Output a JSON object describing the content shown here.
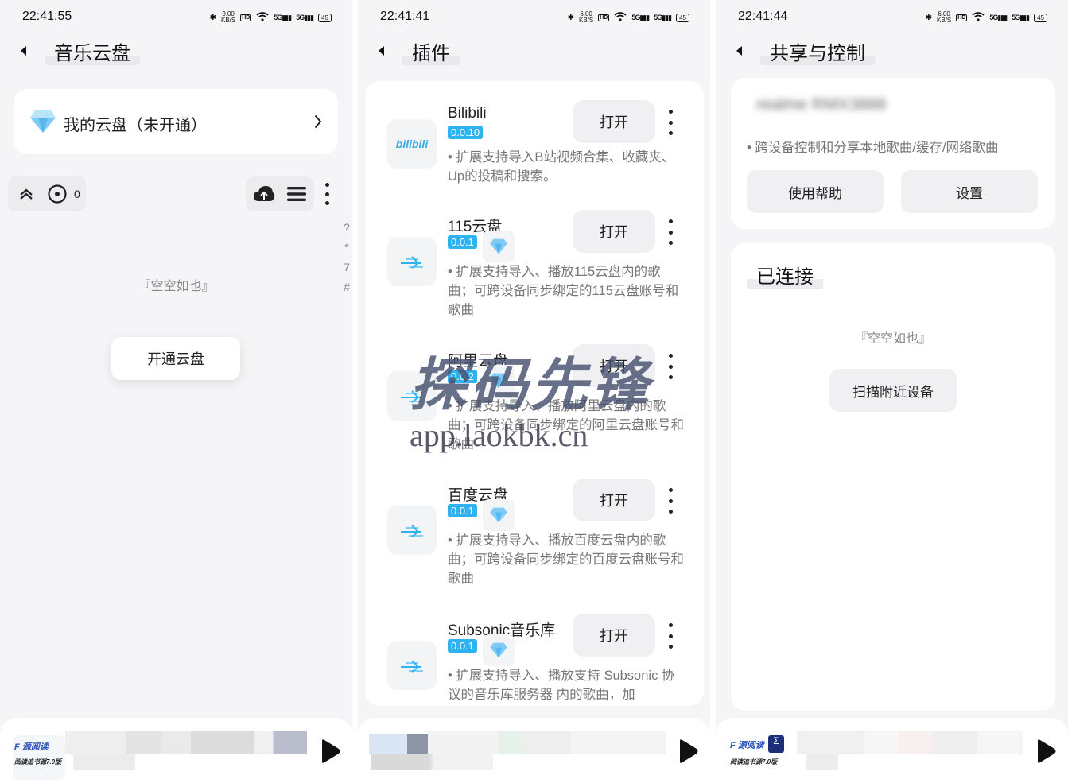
{
  "panels": [
    {
      "status": {
        "time": "22:41:55",
        "speed": "9.00",
        "speed_unit": "KB/S",
        "battery": "45"
      },
      "title": "音乐云盘",
      "cloud_entry": "我的云盘（未开通）",
      "counter": "0",
      "index_letters": [
        "?",
        "*",
        "7",
        "#"
      ],
      "empty_text": "『空空如也』",
      "open_cloud_button": "开通云盘"
    },
    {
      "status": {
        "time": "22:41:41",
        "speed": "6.00",
        "speed_unit": "KB/S",
        "battery": "45"
      },
      "title": "插件",
      "plugins": [
        {
          "name": "Bilibili",
          "version": "0.0.10",
          "button": "打开",
          "desc": "• 扩展支持导入B站视频合集、收藏夹、Up的投稿和搜索。"
        },
        {
          "name": "115云盘",
          "version": "0.0.1",
          "button": "打开",
          "desc": "• 扩展支持导入、播放115云盘内的歌曲；可跨设备同步绑定的115云盘账号和歌曲"
        },
        {
          "name": "阿里云盘",
          "version": "0.0.2",
          "button": "打开",
          "desc": "• 扩展支持导入、播放阿里云盘内的歌曲；可跨设备同步绑定的阿里云盘账号和歌曲"
        },
        {
          "name": "百度云盘",
          "version": "0.0.1",
          "button": "打开",
          "desc": "• 扩展支持导入、播放百度云盘内的歌曲；可跨设备同步绑定的百度云盘账号和歌曲"
        },
        {
          "name": "Subsonic音乐库",
          "version": "0.0.1",
          "button": "打开",
          "desc": "• 扩展支持导入、播放支持 Subsonic 协议的音乐库服务器 内的歌曲，加"
        }
      ],
      "watermark": {
        "line1": "探码先锋",
        "line2": "app.laokbk.cn"
      }
    },
    {
      "status": {
        "time": "22:41:44",
        "speed": "6.00",
        "speed_unit": "KB/S",
        "battery": "45"
      },
      "title": "共享与控制",
      "device_name": "realme RMX3888",
      "device_desc": "• 跨设备控制和分享本地歌曲/缓存/网络歌曲",
      "help_button": "使用帮助",
      "settings_button": "设置",
      "connected_title": "已连接",
      "empty_text": "『空空如也』",
      "scan_button": "扫描附近设备"
    }
  ],
  "player": {
    "thumb_text_1": "F 源阅读",
    "thumb_text_2": "阅读追书源7.0版"
  },
  "colors": {
    "accent": "#2fb2f0",
    "panel_bg": "#f5f5f7",
    "card_bg": "#ffffff"
  }
}
